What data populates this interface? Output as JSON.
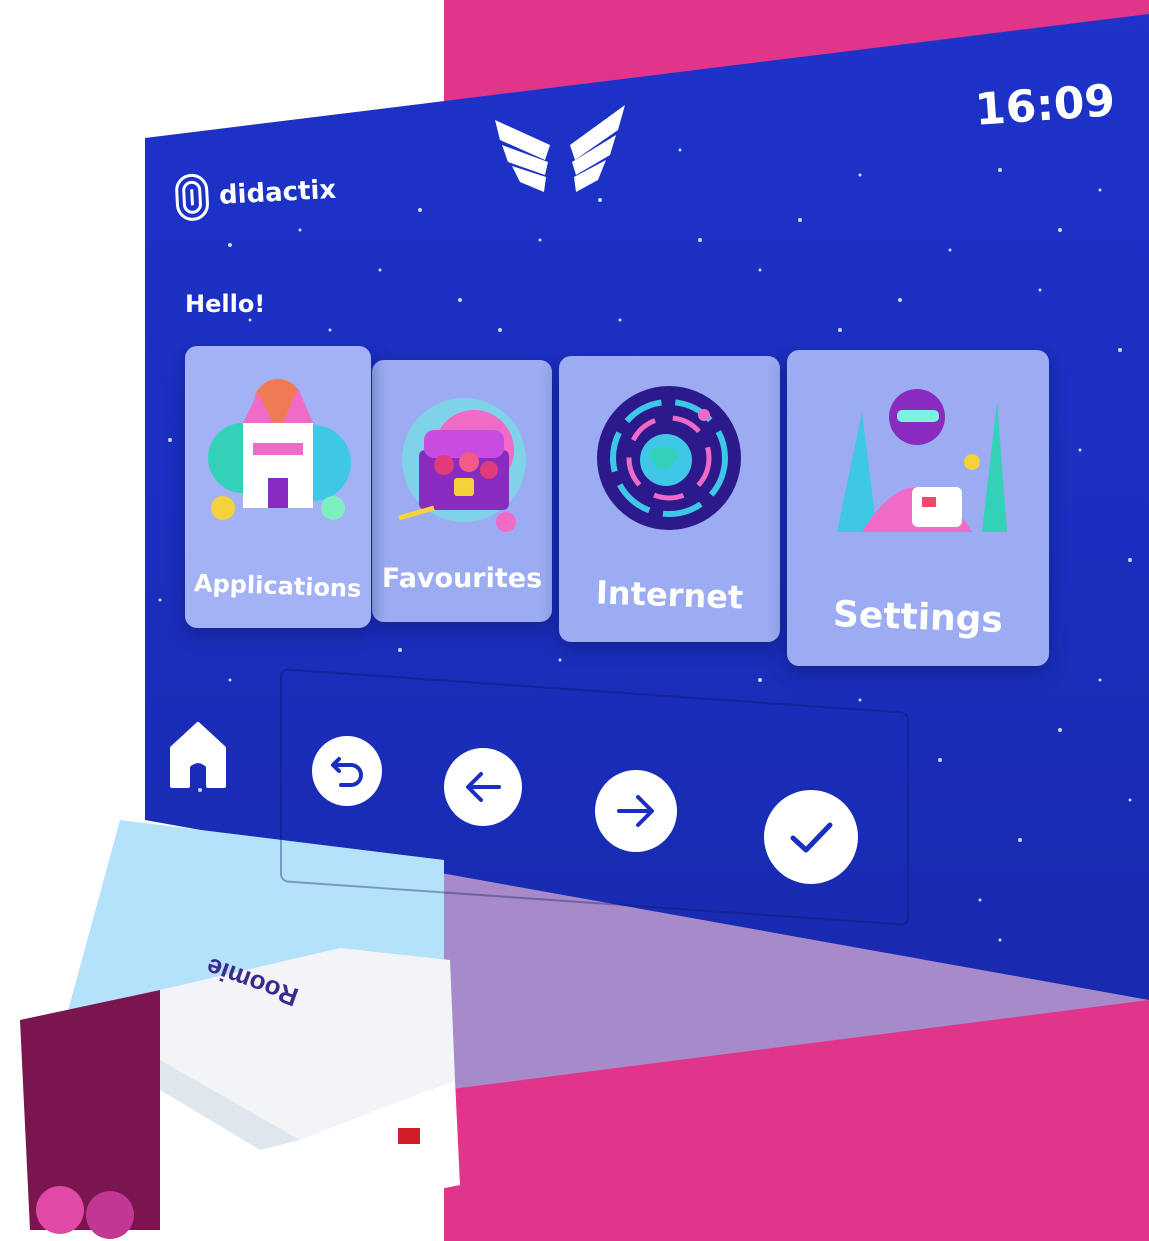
{
  "header": {
    "brand_name": "didactix",
    "clock": "16:09",
    "logo_icon": "wings-icon"
  },
  "main": {
    "greeting": "Hello!",
    "tiles": [
      {
        "label": "Applications",
        "icon": "castle-illustration"
      },
      {
        "label": "Favourites",
        "icon": "treasure-chest-illustration"
      },
      {
        "label": "Internet",
        "icon": "globe-illustration"
      },
      {
        "label": "Settings",
        "icon": "person-settings-illustration"
      }
    ]
  },
  "navigation": {
    "buttons": [
      {
        "name": "home",
        "icon": "home-icon"
      },
      {
        "name": "back",
        "icon": "undo-icon"
      },
      {
        "name": "previous",
        "icon": "arrow-left-icon"
      },
      {
        "name": "next",
        "icon": "arrow-right-icon"
      },
      {
        "name": "confirm",
        "icon": "check-icon"
      }
    ]
  },
  "device": {
    "brand_label": "Roomie"
  },
  "colors": {
    "background_pink": "#e0358a",
    "screen_blue": "#1d33c9",
    "tile_bg": "#9bacf2",
    "floor_purple": "#a68ac9",
    "beam_blue": "#b4e2fb"
  }
}
